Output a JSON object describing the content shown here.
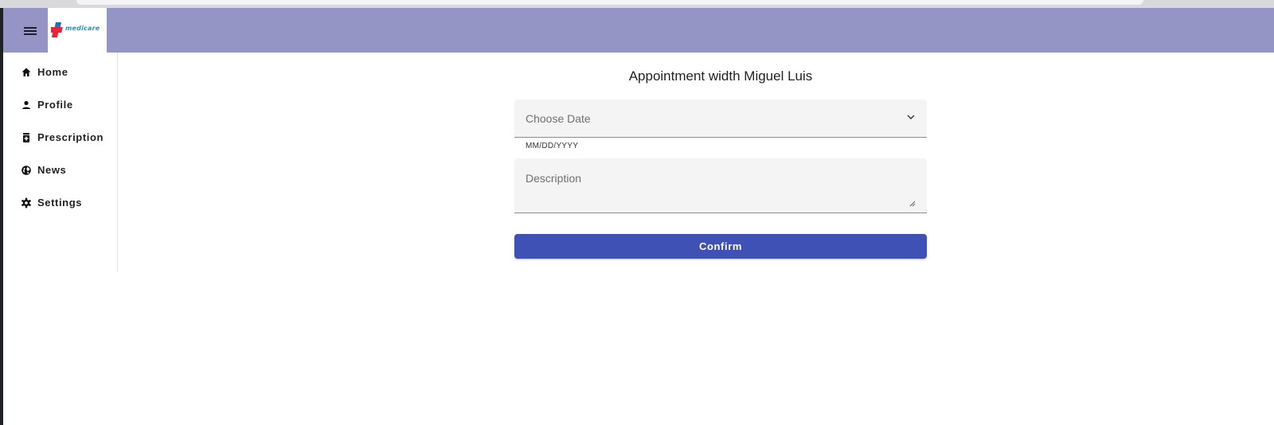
{
  "app": {
    "logo_text": "medicare"
  },
  "sidebar": {
    "items": [
      {
        "label": "Home",
        "icon": "home-icon"
      },
      {
        "label": "Profile",
        "icon": "person-icon"
      },
      {
        "label": "Prescription",
        "icon": "prescription-icon"
      },
      {
        "label": "News",
        "icon": "globe-icon"
      },
      {
        "label": "Settings",
        "icon": "gear-icon"
      }
    ]
  },
  "main": {
    "title": "Appointment width Miguel Luis",
    "date_select": {
      "placeholder": "Choose Date",
      "hint": "MM/DD/YYYY"
    },
    "description": {
      "placeholder": "Description"
    },
    "confirm_label": "Confirm"
  },
  "colors": {
    "topbar": "#9595c5",
    "primary_button": "#3f51b5",
    "field_background": "#f4f4f4"
  }
}
